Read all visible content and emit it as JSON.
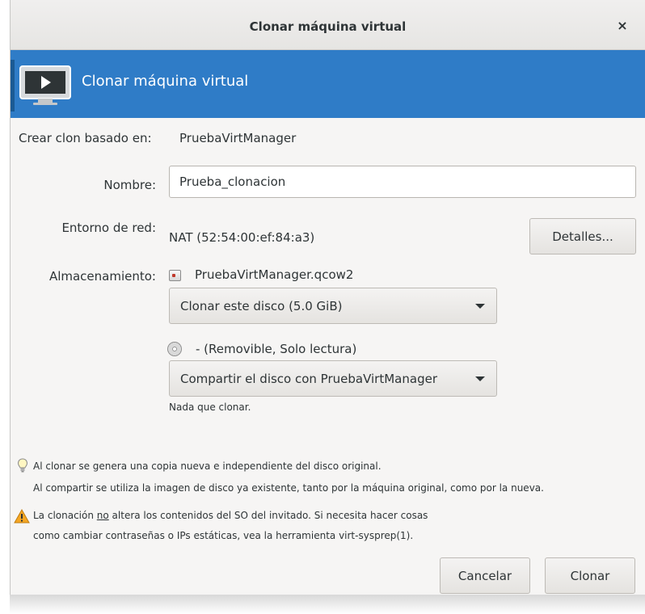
{
  "window": {
    "title": "Clonar máquina virtual",
    "close_glyph": "×"
  },
  "banner": {
    "title": "Clonar máquina virtual",
    "icon": "monitor-play-icon",
    "color": "#2f7cc7"
  },
  "source": {
    "label": "Crear clon basado en:",
    "vm_name": "PruebaVirtManager"
  },
  "name_field": {
    "label": "Nombre:",
    "value": "Prueba_clonacion"
  },
  "network": {
    "label": "Entorno de red:",
    "value": "NAT (52:54:00:ef:84:a3)",
    "details_button": "Detalles..."
  },
  "storage": {
    "label": "Almacenamiento:",
    "disk1": {
      "icon": "hard-disk-icon",
      "filename": "PruebaVirtManager.qcow2",
      "action_selected": "Clonar este disco (5.0 GiB)"
    },
    "disk2": {
      "icon": "cdrom-icon",
      "description": "- (Removible, Solo lectura)",
      "action_selected": "Compartir el disco con PruebaVirtManager",
      "note": "Nada que clonar."
    }
  },
  "info": {
    "icon": "lightbulb-icon",
    "line1": "Al clonar se genera una copia nueva e independiente del disco original.",
    "line2": "Al compartir se utiliza la imagen de disco ya existente, tanto por la máquina original, como por la nueva."
  },
  "warning": {
    "icon": "warning-icon",
    "line1_pre": "La clonación ",
    "line1_underlined": "no",
    "line1_post": " altera los contenidos del SO del invitado. Si necesita hacer cosas",
    "line2": "como cambiar contraseñas o IPs estáticas, vea la herramienta virt-sysprep(1).",
    "color": "#f5a623"
  },
  "buttons": {
    "cancel": "Cancelar",
    "clone": "Clonar"
  }
}
